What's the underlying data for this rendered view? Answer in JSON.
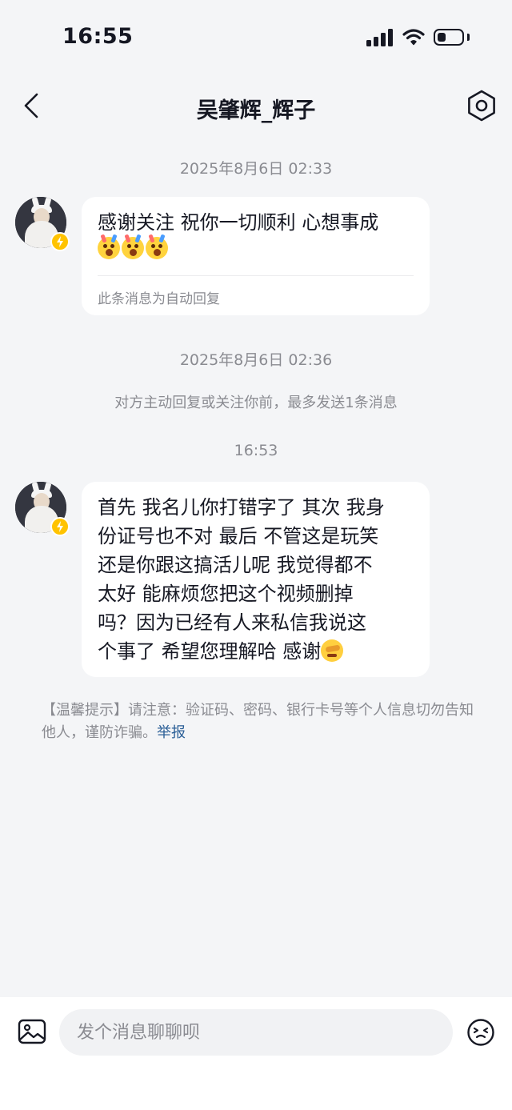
{
  "status_bar": {
    "time": "16:55"
  },
  "header": {
    "title": "吴肇辉_辉子"
  },
  "messages": [
    {
      "timestamp": "2025年8月6日 02:33",
      "text": "感谢关注 祝你一切顺利 心想事成",
      "emojis": [
        "crying-face-emoji",
        "crying-face-emoji",
        "crying-face-emoji"
      ],
      "footer": "此条消息为自动回复"
    },
    {
      "timestamp": "2025年8月6日 02:36",
      "notice": "对方主动回复或关注你前，最多发送1条消息"
    },
    {
      "timestamp": "16:53",
      "text": "首先 我名儿你打错字了 其次 我身\n份证号也不对 最后 不管这是玩笑\n还是你跟这搞活儿呢 我觉得都不\n太好 能麻烦您把这个视频删掉\n吗？因为已经有人来私信我说这\n个事了 希望您理解哈 感谢",
      "emojis": [
        "salute-emoji"
      ]
    }
  ],
  "tip": {
    "text": "【温馨提示】请注意：验证码、密码、银行卡号等个人信息切勿告知他人，谨防诈骗。",
    "link": "举报"
  },
  "composer": {
    "placeholder": "发个消息聊聊呗"
  },
  "colors": {
    "background": "#f4f5f7",
    "bubble": "#ffffff",
    "muted_text": "#8a8b91",
    "link": "#2b5f97",
    "badge": "#ffc300"
  },
  "icons": [
    "back-arrow-icon",
    "settings-hexagon-icon",
    "image-icon",
    "emoji-icon",
    "lightning-badge-icon"
  ]
}
